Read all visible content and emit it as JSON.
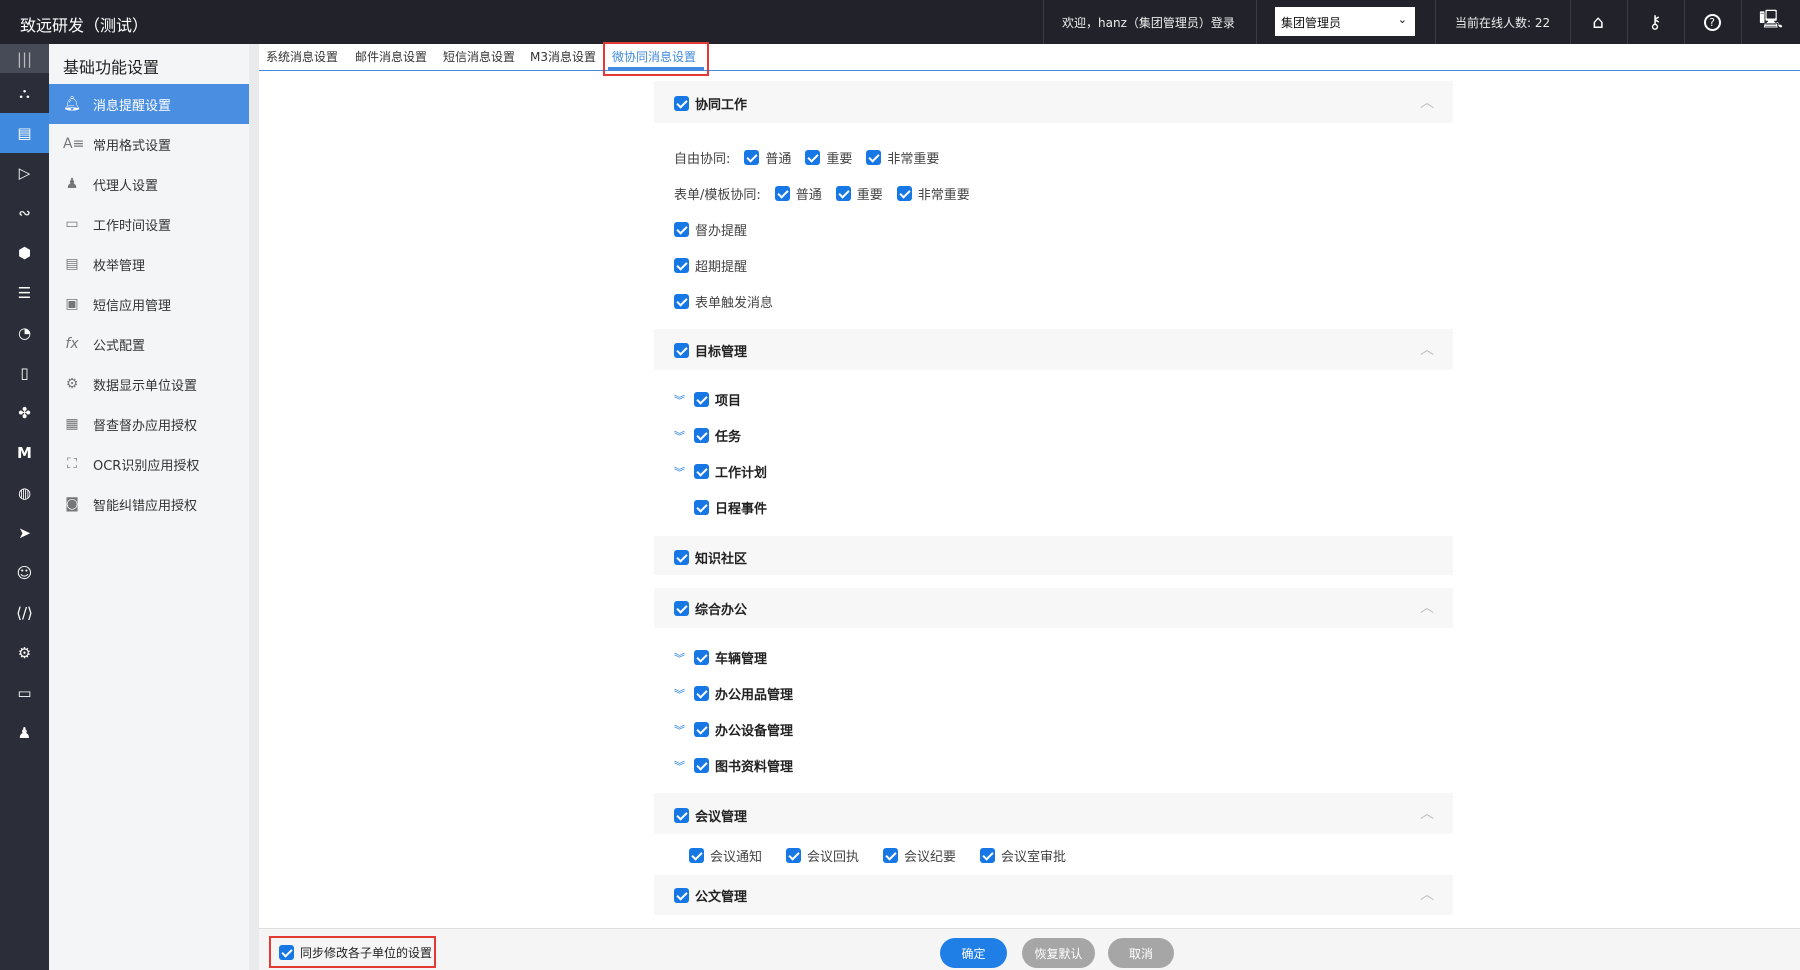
{
  "header": {
    "app_title": "致远研发（测试）",
    "welcome": "欢迎，hanz（集团管理员）登录",
    "role_select": "集团管理员",
    "online_count": "当前在线人数: 22",
    "icons": [
      "home-icon",
      "key-icon",
      "help-icon",
      "monitor-icon"
    ]
  },
  "submenu": {
    "title": "基础功能设置",
    "items": [
      {
        "label": "消息提醒设置",
        "icon": "bell-icon",
        "active": true
      },
      {
        "label": "常用格式设置"
      },
      {
        "label": "代理人设置"
      },
      {
        "label": "工作时间设置"
      },
      {
        "label": "枚举管理"
      },
      {
        "label": "短信应用管理"
      },
      {
        "label": "公式配置"
      },
      {
        "label": "数据显示单位设置"
      },
      {
        "label": "督查督办应用授权"
      },
      {
        "label": "OCR识别应用授权"
      },
      {
        "label": "智能纠错应用授权"
      }
    ]
  },
  "tabs": [
    "系统消息设置",
    "邮件消息设置",
    "短信消息设置",
    "M3消息设置",
    "微协同消息设置"
  ],
  "sections": {
    "collab": {
      "title": "协同工作",
      "free_label": "自由协同:",
      "form_label": "表单/模板协同:",
      "levels": [
        "普通",
        "重要",
        "非常重要"
      ],
      "items": [
        "督办提醒",
        "超期提醒",
        "表单触发消息"
      ]
    },
    "goal": {
      "title": "目标管理",
      "items": [
        "项目",
        "任务",
        "工作计划",
        "日程事件"
      ]
    },
    "knowledge": {
      "title": "知识社区"
    },
    "office": {
      "title": "综合办公",
      "items": [
        "车辆管理",
        "办公用品管理",
        "办公设备管理",
        "图书资料管理"
      ]
    },
    "meeting": {
      "title": "会议管理",
      "items": [
        "会议通知",
        "会议回执",
        "会议纪要",
        "会议室审批"
      ]
    },
    "doc": {
      "title": "公文管理"
    }
  },
  "footer": {
    "sync_label": "同步修改各子单位的设置",
    "confirm": "确定",
    "restore": "恢复默认",
    "cancel": "取消"
  }
}
